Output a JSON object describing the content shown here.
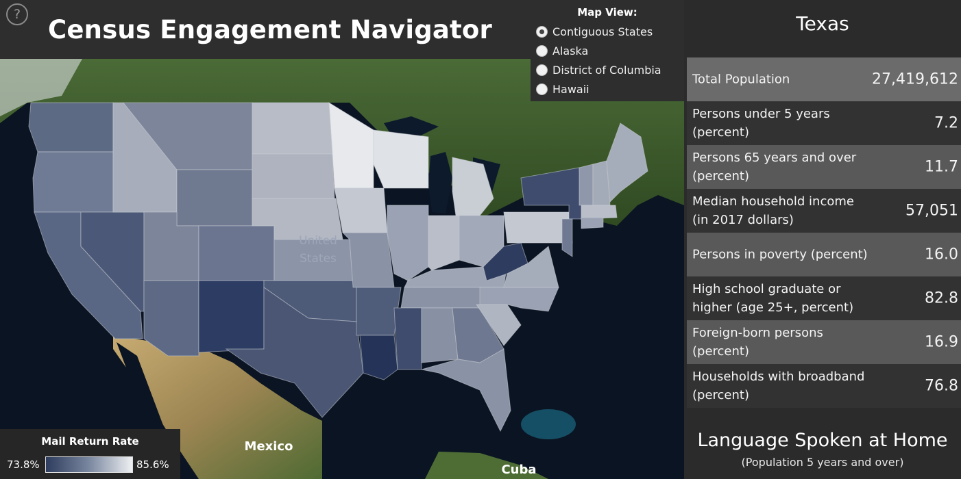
{
  "header": {
    "title": "Census Engagement Navigator",
    "help_icon": "?"
  },
  "map_view": {
    "title": "Map View:",
    "options": [
      {
        "label": "Contiguous States",
        "checked": true
      },
      {
        "label": "Alaska",
        "checked": false
      },
      {
        "label": "District of Columbia",
        "checked": false
      },
      {
        "label": "Hawaii",
        "checked": false
      }
    ]
  },
  "map": {
    "country_label": "United States",
    "country_label_line1": "United",
    "country_label_line2": "States",
    "labels": {
      "mexico": "Mexico",
      "cuba": "Cuba"
    },
    "colors": {
      "ocean": "#0b1422",
      "land_forest": "#3d5a2a",
      "land_desert": "#b39865",
      "low": "#2e3c5e",
      "high": "#eef0f2"
    }
  },
  "legend": {
    "title": "Mail Return Rate",
    "min": "73.8%",
    "max": "85.6%"
  },
  "panel": {
    "state": "Texas",
    "stats": [
      {
        "label": "Total Population",
        "value": "27,419,612"
      },
      {
        "label": "Persons under 5 years (percent)",
        "value": "7.2"
      },
      {
        "label": "Persons 65 years and over (percent)",
        "value": "11.7"
      },
      {
        "label": "Median household income (in 2017 dollars)",
        "value": "57,051"
      },
      {
        "label": "Persons in poverty (percent)",
        "value": "16.0"
      },
      {
        "label": "High school graduate or higher (age 25+, percent)",
        "value": "82.8"
      },
      {
        "label": "Foreign-born persons (percent)",
        "value": "16.9"
      },
      {
        "label": "Households with broadband (percent)",
        "value": "76.8"
      }
    ],
    "language_title": "Language Spoken at Home",
    "language_subtitle": "(Population 5 years and over)"
  }
}
